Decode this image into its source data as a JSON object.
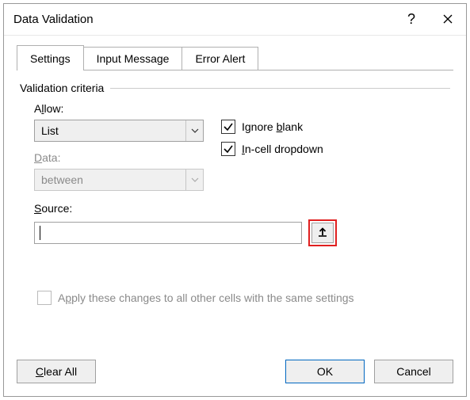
{
  "title": "Data Validation",
  "tabs": {
    "settings": "Settings",
    "input_message": "Input Message",
    "error_alert": "Error Alert"
  },
  "fieldset_label": "Validation criteria",
  "allow": {
    "label_pre": "A",
    "label_u": "l",
    "label_post": "low:",
    "value": "List"
  },
  "data": {
    "label_pre": "",
    "label_u": "D",
    "label_post": "ata:",
    "value": "between"
  },
  "ignore_blank": {
    "pre": "Ignore ",
    "u": "b",
    "post": "lank"
  },
  "in_cell": {
    "pre": "",
    "u": "I",
    "post": "n-cell dropdown"
  },
  "source": {
    "label_pre": "",
    "label_u": "S",
    "label_post": "ource:",
    "value": ""
  },
  "apply": {
    "pre": "A",
    "u": "p",
    "post": "ply these changes to all other cells with the same settings"
  },
  "buttons": {
    "clear_pre": "",
    "clear_u": "C",
    "clear_post": "lear All",
    "ok": "OK",
    "cancel": "Cancel"
  }
}
